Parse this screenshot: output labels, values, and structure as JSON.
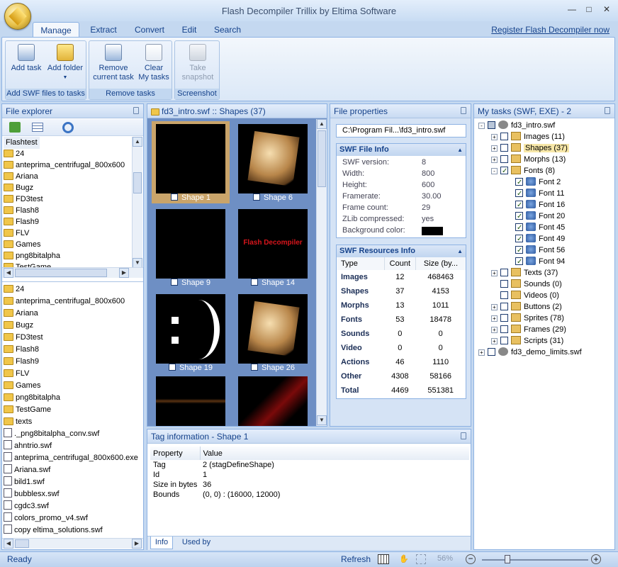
{
  "window": {
    "title": "Flash Decompiler Trillix by Eltima Software"
  },
  "menu": {
    "tabs": [
      "Manage",
      "Extract",
      "Convert",
      "Edit",
      "Search"
    ],
    "register_link": "Register Flash Decompiler now"
  },
  "ribbon": {
    "add_task": "Add task",
    "add_folder": "Add folder",
    "group_add": "Add SWF files to tasks",
    "remove_current_1": "Remove",
    "remove_current_2": "current task",
    "clear_1": "Clear",
    "clear_2": "My tasks",
    "group_remove": "Remove tasks",
    "snapshot_1": "Take",
    "snapshot_2": "snapshot",
    "group_screenshot": "Screenshot"
  },
  "explorer": {
    "title": "File explorer",
    "root": "Flashtest",
    "folders_top": [
      "24",
      "anteprima_centrifugal_800x600",
      "Ariana",
      "Bugz",
      "FD3test",
      "Flash8",
      "Flash9",
      "FLV",
      "Games",
      "png8bitalpha",
      "TestGame"
    ],
    "folders_bottom": [
      "24",
      "anteprima_centrifugal_800x600",
      "Ariana",
      "Bugz",
      "FD3test",
      "Flash8",
      "Flash9",
      "FLV",
      "Games",
      "png8bitalpha",
      "TestGame",
      "texts"
    ],
    "files": [
      "._png8bitalpha_conv.swf",
      "ahntrio.swf",
      "anteprima_centrifugal_800x600.exe",
      "Ariana.swf",
      "bild1.swf",
      "bubblesx.swf",
      "cgdc3.swf",
      "colors_promo_v4.swf",
      "copy eltima_solutions.swf"
    ]
  },
  "shapes": {
    "title": "fd3_intro.swf :: Shapes (37)",
    "items": [
      {
        "label": "Shape 1"
      },
      {
        "label": "Shape 6"
      },
      {
        "label": "Shape 9"
      },
      {
        "label": "Shape 14",
        "text": "Flash Decompiler"
      },
      {
        "label": "Shape 19"
      },
      {
        "label": "Shape 26"
      }
    ]
  },
  "props": {
    "title": "File properties",
    "path": "C:\\Program Fil...\\fd3_intro.swf",
    "info_title": "SWF File Info",
    "info": [
      {
        "k": "SWF version:",
        "v": "8"
      },
      {
        "k": "Width:",
        "v": "800"
      },
      {
        "k": "Height:",
        "v": "600"
      },
      {
        "k": "Framerate:",
        "v": "30.00"
      },
      {
        "k": "Frame count:",
        "v": "29"
      },
      {
        "k": "ZLib compressed:",
        "v": "yes"
      },
      {
        "k": "Background color:",
        "v": ""
      }
    ],
    "bg_color": "#000000",
    "res_title": "SWF Resources Info",
    "res_headers": [
      "Type",
      "Count",
      "Size (by..."
    ],
    "resources": [
      {
        "type": "Images",
        "count": "12",
        "size": "468463"
      },
      {
        "type": "Shapes",
        "count": "37",
        "size": "4153"
      },
      {
        "type": "Morphs",
        "count": "13",
        "size": "1011"
      },
      {
        "type": "Fonts",
        "count": "53",
        "size": "18478"
      },
      {
        "type": "Sounds",
        "count": "0",
        "size": "0"
      },
      {
        "type": "Video",
        "count": "0",
        "size": "0"
      },
      {
        "type": "Actions",
        "count": "46",
        "size": "1110"
      },
      {
        "type": "Other",
        "count": "4308",
        "size": "58166"
      },
      {
        "type": "Total",
        "count": "4469",
        "size": "551381"
      }
    ]
  },
  "tasks": {
    "title": "My tasks (SWF, EXE) - 2",
    "root": "fd3_intro.swf",
    "nodes": [
      {
        "label": "Images (11)",
        "exp": "+"
      },
      {
        "label": "Shapes (37)",
        "exp": "+"
      },
      {
        "label": "Morphs (13)",
        "exp": "+"
      },
      {
        "label": "Fonts (8)",
        "exp": "-"
      },
      {
        "label": "Texts (37)",
        "exp": "+"
      },
      {
        "label": "Sounds (0)",
        "exp": ""
      },
      {
        "label": "Videos (0)",
        "exp": ""
      },
      {
        "label": "Buttons (2)",
        "exp": "+"
      },
      {
        "label": "Sprites (78)",
        "exp": "+"
      },
      {
        "label": "Frames (29)",
        "exp": "+"
      },
      {
        "label": "Scripts (31)",
        "exp": "+"
      }
    ],
    "fonts": [
      "Font 2",
      "Font 11",
      "Font 16",
      "Font 20",
      "Font 45",
      "Font 49",
      "Font 56",
      "Font 94"
    ],
    "second": "fd3_demo_limits.swf"
  },
  "taginfo": {
    "title": "Tag information - Shape 1",
    "headers": [
      "Property",
      "Value"
    ],
    "rows": [
      {
        "k": "Tag",
        "v": "2 (stagDefineShape)"
      },
      {
        "k": "Id",
        "v": "1"
      },
      {
        "k": "Size in bytes",
        "v": "36"
      },
      {
        "k": "Bounds",
        "v": "(0, 0) : (16000, 12000)"
      }
    ],
    "tab_info": "Info",
    "tab_used": "Used by"
  },
  "status": {
    "ready": "Ready",
    "refresh": "Refresh",
    "zoom": "56%"
  }
}
